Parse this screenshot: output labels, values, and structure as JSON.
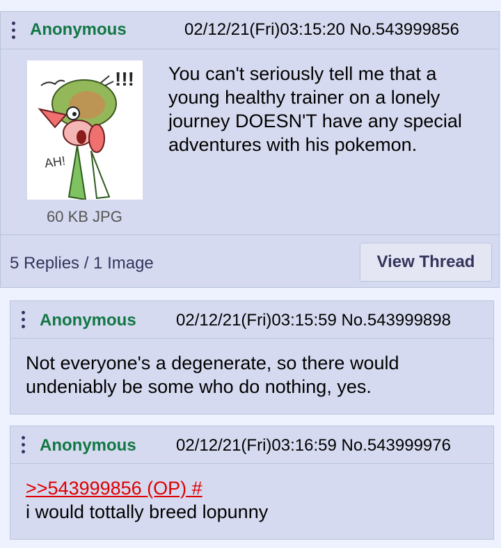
{
  "op": {
    "name": "Anonymous",
    "datetime": "02/12/21(Fri)03:15:20",
    "post_no": "No.543999856",
    "file_info": "60 KB JPG",
    "text": "You can't seriously tell me that a young healthy trainer on a lonely journey DOESN'T have any special adventures with his pokemon.",
    "image_caption": "AH!",
    "image_exclaim": "!!!",
    "replies_summary": "5 Replies / 1 Image",
    "view_thread_label": "View Thread"
  },
  "replies": [
    {
      "name": "Anonymous",
      "datetime": "02/12/21(Fri)03:15:59",
      "post_no": "No.543999898",
      "text": "Not everyone's a degenerate, so there would undeniably be some who do nothing, yes."
    },
    {
      "name": "Anonymous",
      "datetime": "02/12/21(Fri)03:16:59",
      "post_no": "No.543999976",
      "quote_link": ">>543999856 (OP) #",
      "text": "i would tottally breed lopunny"
    }
  ],
  "colors": {
    "name": "#117743",
    "post_bg": "#d6daf0",
    "border": "#b7c5d9",
    "quote": "#dd0000"
  }
}
